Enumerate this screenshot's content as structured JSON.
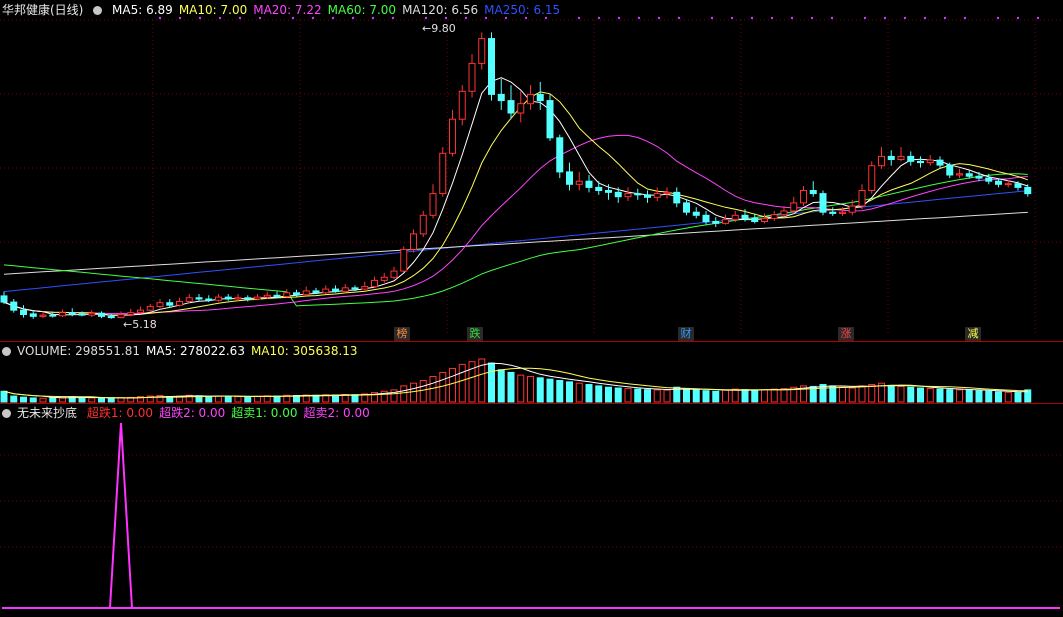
{
  "main_legend": {
    "stock": "华邦健康(日线)",
    "ma": [
      {
        "label": "MA5: 6.89",
        "color": "#ffffff"
      },
      {
        "label": "MA10: 7.00",
        "color": "#ffff55"
      },
      {
        "label": "MA20: 7.22",
        "color": "#ff44ff"
      },
      {
        "label": "MA60: 7.00",
        "color": "#44ff44"
      },
      {
        "label": "MA120: 6.56",
        "color": "#dddddd"
      },
      {
        "label": "MA250: 6.15",
        "color": "#3050ff"
      }
    ]
  },
  "annotations": {
    "high": "9.80",
    "low": "5.18"
  },
  "event_tags": [
    {
      "text": "榜",
      "color": "#ff8a3d"
    },
    {
      "text": "跌",
      "color": "#33dd33"
    },
    {
      "text": "财",
      "color": "#3399ff"
    },
    {
      "text": "涨",
      "color": "#ff4040"
    },
    {
      "text": "减",
      "color": "#ffff44"
    }
  ],
  "volume_legend": [
    {
      "label": "VOLUME: 298551.81",
      "color": "#dddddd"
    },
    {
      "label": "MA5: 278022.63",
      "color": "#ffffff"
    },
    {
      "label": "MA10: 305638.13",
      "color": "#ffff55"
    }
  ],
  "indicator_legend": {
    "name": "无未来抄底",
    "items": [
      {
        "label": "超跌1: 0.00",
        "color": "#ff3030"
      },
      {
        "label": "超跌2: 0.00",
        "color": "#ff44ff"
      },
      {
        "label": "超卖1: 0.00",
        "color": "#44ff44"
      },
      {
        "label": "超卖2: 0.00",
        "color": "#ff44ff"
      }
    ]
  },
  "colors": {
    "up": "#ff3232",
    "down": "#54ffff",
    "grid": "#7a0000",
    "spike": "#ff33ff"
  },
  "chart_data": {
    "type": "candlestick",
    "price_range": [
      5.0,
      10.0
    ],
    "candles": [
      [
        5.55,
        5.45,
        5.62,
        5.42
      ],
      [
        5.45,
        5.32,
        5.5,
        5.28
      ],
      [
        5.32,
        5.25,
        5.4,
        5.2
      ],
      [
        5.26,
        5.22,
        5.32,
        5.18
      ],
      [
        5.22,
        5.24,
        5.3,
        5.19
      ],
      [
        5.24,
        5.23,
        5.3,
        5.2
      ],
      [
        5.23,
        5.28,
        5.33,
        5.21
      ],
      [
        5.28,
        5.26,
        5.35,
        5.22
      ],
      [
        5.26,
        5.24,
        5.3,
        5.22
      ],
      [
        5.24,
        5.27,
        5.32,
        5.21
      ],
      [
        5.27,
        5.22,
        5.3,
        5.19
      ],
      [
        5.22,
        5.2,
        5.26,
        5.18
      ],
      [
        5.2,
        5.25,
        5.3,
        5.19
      ],
      [
        5.25,
        5.28,
        5.34,
        5.22
      ],
      [
        5.28,
        5.32,
        5.38,
        5.26
      ],
      [
        5.32,
        5.38,
        5.42,
        5.3
      ],
      [
        5.38,
        5.44,
        5.5,
        5.35
      ],
      [
        5.44,
        5.4,
        5.5,
        5.36
      ],
      [
        5.4,
        5.46,
        5.52,
        5.38
      ],
      [
        5.46,
        5.52,
        5.58,
        5.43
      ],
      [
        5.52,
        5.5,
        5.58,
        5.46
      ],
      [
        5.5,
        5.48,
        5.56,
        5.45
      ],
      [
        5.48,
        5.53,
        5.58,
        5.46
      ],
      [
        5.53,
        5.5,
        5.58,
        5.47
      ],
      [
        5.5,
        5.52,
        5.58,
        5.47
      ],
      [
        5.52,
        5.5,
        5.56,
        5.46
      ],
      [
        5.5,
        5.53,
        5.58,
        5.48
      ],
      [
        5.53,
        5.56,
        5.62,
        5.5
      ],
      [
        5.56,
        5.54,
        5.62,
        5.51
      ],
      [
        5.54,
        5.6,
        5.66,
        5.52
      ],
      [
        5.6,
        5.57,
        5.65,
        5.54
      ],
      [
        5.57,
        5.63,
        5.7,
        5.55
      ],
      [
        5.63,
        5.6,
        5.68,
        5.58
      ],
      [
        5.6,
        5.66,
        5.72,
        5.58
      ],
      [
        5.66,
        5.62,
        5.72,
        5.6
      ],
      [
        5.62,
        5.68,
        5.74,
        5.6
      ],
      [
        5.68,
        5.66,
        5.72,
        5.63
      ],
      [
        5.66,
        5.7,
        5.78,
        5.64
      ],
      [
        5.7,
        5.8,
        5.86,
        5.68
      ],
      [
        5.8,
        5.85,
        5.92,
        5.76
      ],
      [
        5.85,
        5.95,
        6.02,
        5.82
      ],
      [
        5.95,
        6.3,
        6.35,
        5.93
      ],
      [
        6.3,
        6.55,
        6.62,
        6.25
      ],
      [
        6.55,
        6.85,
        6.92,
        6.5
      ],
      [
        6.85,
        7.2,
        7.35,
        6.8
      ],
      [
        7.2,
        7.85,
        7.95,
        7.15
      ],
      [
        7.85,
        8.4,
        8.55,
        7.8
      ],
      [
        8.4,
        8.85,
        8.95,
        8.3
      ],
      [
        8.85,
        9.3,
        9.45,
        8.75
      ],
      [
        9.3,
        9.7,
        9.8,
        9.2
      ],
      [
        9.7,
        8.8,
        9.8,
        8.7
      ],
      [
        8.8,
        8.7,
        9.05,
        8.55
      ],
      [
        8.7,
        8.5,
        8.95,
        8.4
      ],
      [
        8.5,
        8.65,
        8.85,
        8.35
      ],
      [
        8.65,
        8.8,
        8.95,
        8.55
      ],
      [
        8.8,
        8.7,
        9.0,
        8.55
      ],
      [
        8.7,
        8.1,
        8.8,
        8.05
      ],
      [
        8.1,
        7.55,
        8.15,
        7.45
      ],
      [
        7.55,
        7.35,
        7.7,
        7.25
      ],
      [
        7.35,
        7.4,
        7.55,
        7.25
      ],
      [
        7.4,
        7.3,
        7.5,
        7.22
      ],
      [
        7.3,
        7.25,
        7.4,
        7.18
      ],
      [
        7.25,
        7.22,
        7.35,
        7.1
      ],
      [
        7.22,
        7.15,
        7.3,
        7.05
      ],
      [
        7.15,
        7.2,
        7.3,
        7.08
      ],
      [
        7.2,
        7.18,
        7.28,
        7.1
      ],
      [
        7.18,
        7.14,
        7.25,
        7.05
      ],
      [
        7.14,
        7.2,
        7.3,
        7.08
      ],
      [
        7.2,
        7.22,
        7.3,
        7.12
      ],
      [
        7.22,
        7.05,
        7.3,
        6.98
      ],
      [
        7.05,
        6.9,
        7.1,
        6.85
      ],
      [
        6.9,
        6.85,
        6.98,
        6.8
      ],
      [
        6.85,
        6.75,
        6.92,
        6.7
      ],
      [
        6.75,
        6.72,
        6.82,
        6.66
      ],
      [
        6.72,
        6.78,
        6.86,
        6.7
      ],
      [
        6.78,
        6.85,
        6.92,
        6.74
      ],
      [
        6.85,
        6.8,
        6.95,
        6.75
      ],
      [
        6.8,
        6.75,
        6.88,
        6.72
      ],
      [
        6.75,
        6.8,
        6.88,
        6.72
      ],
      [
        6.8,
        6.86,
        6.92,
        6.76
      ],
      [
        6.86,
        6.92,
        7.0,
        6.82
      ],
      [
        6.92,
        7.05,
        7.15,
        6.88
      ],
      [
        7.05,
        7.25,
        7.32,
        7.0
      ],
      [
        7.25,
        7.2,
        7.4,
        7.15
      ],
      [
        7.2,
        6.9,
        7.25,
        6.85
      ],
      [
        6.9,
        6.88,
        6.98,
        6.84
      ],
      [
        6.88,
        6.9,
        6.98,
        6.84
      ],
      [
        6.9,
        7.0,
        7.1,
        6.85
      ],
      [
        7.0,
        7.25,
        7.35,
        6.95
      ],
      [
        7.25,
        7.65,
        7.72,
        7.2
      ],
      [
        7.65,
        7.8,
        7.95,
        7.6
      ],
      [
        7.8,
        7.75,
        7.9,
        7.65
      ],
      [
        7.75,
        7.8,
        7.95,
        7.72
      ],
      [
        7.8,
        7.72,
        7.88,
        7.65
      ],
      [
        7.72,
        7.7,
        7.8,
        7.62
      ],
      [
        7.7,
        7.74,
        7.82,
        7.65
      ],
      [
        7.74,
        7.66,
        7.8,
        7.6
      ],
      [
        7.66,
        7.5,
        7.7,
        7.45
      ],
      [
        7.5,
        7.52,
        7.6,
        7.45
      ],
      [
        7.52,
        7.48,
        7.58,
        7.44
      ],
      [
        7.48,
        7.45,
        7.55,
        7.4
      ],
      [
        7.45,
        7.4,
        7.52,
        7.35
      ],
      [
        7.4,
        7.35,
        7.45,
        7.3
      ],
      [
        7.35,
        7.36,
        7.42,
        7.3
      ],
      [
        7.36,
        7.3,
        7.4,
        7.25
      ],
      [
        7.3,
        7.2,
        7.35,
        7.15
      ]
    ],
    "volume": [
      40,
      22,
      18,
      15,
      14,
      16,
      15,
      20,
      18,
      15,
      14,
      13,
      16,
      17,
      20,
      22,
      24,
      20,
      22,
      25,
      23,
      20,
      22,
      21,
      20,
      19,
      21,
      23,
      22,
      25,
      24,
      26,
      25,
      27,
      26,
      28,
      27,
      30,
      35,
      40,
      45,
      60,
      70,
      80,
      95,
      110,
      125,
      140,
      150,
      160,
      145,
      120,
      110,
      100,
      95,
      90,
      85,
      80,
      75,
      70,
      65,
      60,
      55,
      52,
      50,
      48,
      46,
      45,
      44,
      55,
      50,
      45,
      42,
      40,
      44,
      48,
      46,
      44,
      45,
      48,
      50,
      55,
      60,
      58,
      65,
      60,
      55,
      52,
      60,
      65,
      70,
      62,
      58,
      55,
      52,
      50,
      48,
      46,
      45,
      44,
      42,
      40,
      38,
      36,
      35,
      45
    ]
  }
}
